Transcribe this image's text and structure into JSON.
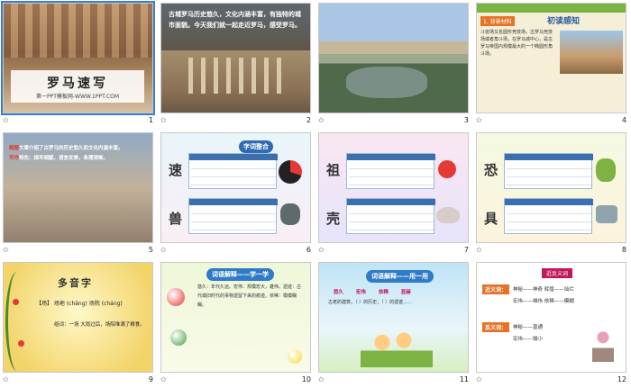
{
  "slides": [
    {
      "num": "1",
      "title": "罗马速写",
      "subtitle": "第一PPT模板网-WWW.1PPT.COM"
    },
    {
      "num": "2",
      "text": "古城罗马历史悠久，文化内涵丰富，有独特的城市面貌。今天我们就一起走近罗马，感受罗马。"
    },
    {
      "num": "3"
    },
    {
      "num": "4",
      "tag": "1. 背景材料",
      "heading": "初读感知",
      "body": "斗兽场又名圆形竞技场。古罗马竞技场或者角斗场，在罗马城中心，是古罗马帝国内规模最大的一个椭圆形角斗场。"
    },
    {
      "num": "5",
      "p1_lead": "精题",
      "p1": "文章介绍了古罗马的历史悠久和文化内涵丰富。",
      "p2_lead": "写作",
      "p2": "特色：描写细腻，语言优美，条理清晰。"
    },
    {
      "num": "6",
      "bubble": "字词整合",
      "chars": [
        "速",
        "兽"
      ]
    },
    {
      "num": "7",
      "chars": [
        "祖",
        "壳"
      ]
    },
    {
      "num": "8",
      "chars": [
        "恐",
        "具"
      ]
    },
    {
      "num": "9",
      "title": "多音字",
      "line1": "【场】 场地 (chǎng) 场院 (cháng)",
      "line2": "组词：一场 大雨过后，场院堆满了粮食。"
    },
    {
      "num": "10",
      "header": "词语解释——学一学",
      "body": "悠久：年代久远。宏伟：规模宏大，雄伟。遗迹：古代或旧时代的事物遗留下来的痕迹。依稀：模模糊糊。"
    },
    {
      "num": "11",
      "header": "词语解释——用一用",
      "words": "悠久 宏伟 依稀 显赫",
      "question": "古老的建筑，（ ）的历史，（ ）的遗迹……"
    },
    {
      "num": "12",
      "header": "近反义词",
      "syn_label": "近义词：",
      "syn1": "神秘——神奇   辉煌——灿烂",
      "syn2": "宏伟——雄伟   依稀——模糊",
      "ant_label": "反义词：",
      "ant1": "神秘——普通",
      "ant2": "宏伟——矮小"
    }
  ],
  "icons": {
    "star": "star-icon"
  }
}
